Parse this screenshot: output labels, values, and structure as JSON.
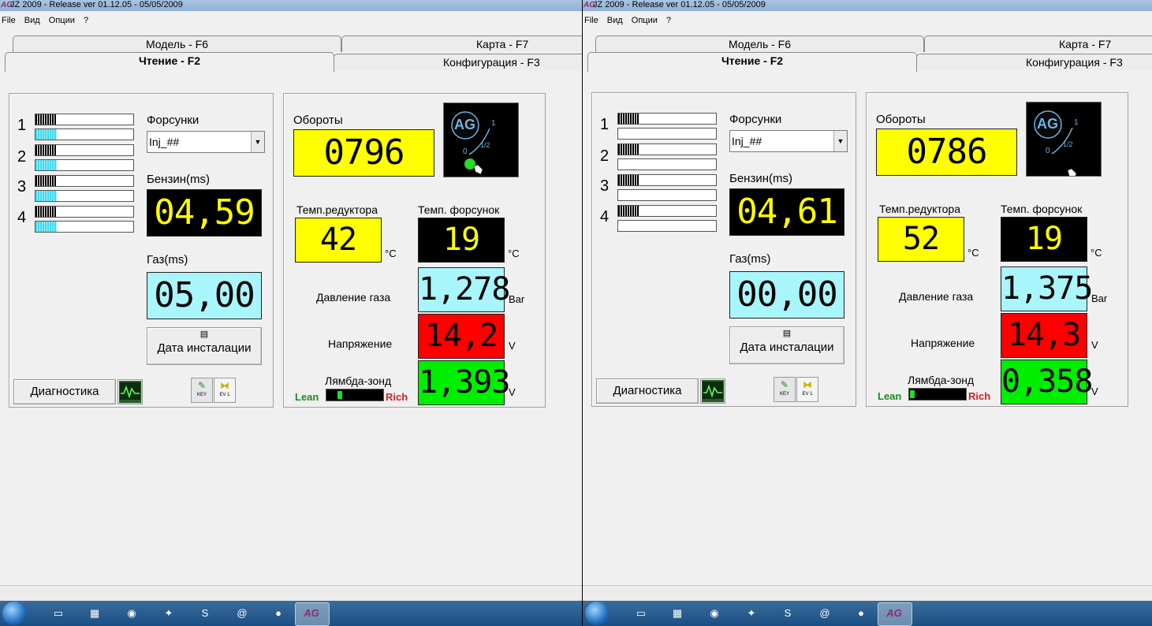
{
  "panes": [
    {
      "title": "JZ 2009  - Release  ver 01.12.05 - 05/05/2009",
      "menu": [
        "File",
        "Вид",
        "Опции",
        "?"
      ],
      "tabs": {
        "model": "Модель - F6",
        "map": "Карта - F7",
        "read": "Чтение - F2",
        "config": "Конфигурация - F3"
      },
      "injectors": {
        "numbers": [
          "1",
          "2",
          "3",
          "4"
        ],
        "petrol_fill": [
          0.22,
          0.22,
          0.22,
          0.22
        ],
        "gas_fill": [
          0.22,
          0.22,
          0.22,
          0.22
        ]
      },
      "injectors_label": "Форсунки",
      "injector_select": "Inj_##",
      "petrol_label": "Бензин(ms)",
      "petrol_value": "04,59",
      "gas_label": "Газ(ms)",
      "gas_value": "05,00",
      "install_date_button": "Дата инсталации",
      "diagnostics_button": "Диагностика",
      "rpm_label": "Обороты",
      "rpm_value": "0796",
      "ag_logo": "AG",
      "ag_scale": {
        "one": "1",
        "half": "1/2",
        "zero": "0"
      },
      "reducer_temp_label": "Темп.редуктора",
      "reducer_temp_value": "42",
      "injector_temp_label": "Темп. форсунок",
      "injector_temp_value": "19",
      "celsius": "°C",
      "gas_pressure_label": "Давление газа",
      "gas_pressure_value": "1,278",
      "pressure_unit": "Bar",
      "voltage_label": "Напряжение",
      "voltage_value": "14,2",
      "volt_unit": "V",
      "lambda_label": "Лямбда-зонд",
      "lambda_value": "1,393",
      "lean": "Lean",
      "rich": "Rich",
      "key_label": "KEY",
      "ev_label": "EV 1"
    },
    {
      "title": "JZ 2009  - Release  ver 01.12.05 - 05/05/2009",
      "menu": [
        "File",
        "Вид",
        "Опции",
        "?"
      ],
      "tabs": {
        "model": "Модель - F6",
        "map": "Карта - F7",
        "read": "Чтение - F2",
        "config": "Конфигурация - F3"
      },
      "injectors": {
        "numbers": [
          "1",
          "2",
          "3",
          "4"
        ],
        "petrol_fill": [
          0.22,
          0.22,
          0.22,
          0.22
        ],
        "gas_fill": [
          0,
          0,
          0,
          0
        ]
      },
      "injectors_label": "Форсунки",
      "injector_select": "Inj_##",
      "petrol_label": "Бензин(ms)",
      "petrol_value": "04,61",
      "gas_label": "Газ(ms)",
      "gas_value": "00,00",
      "install_date_button": "Дата инсталации",
      "diagnostics_button": "Диагностика",
      "rpm_label": "Обороты",
      "rpm_value": "0786",
      "ag_logo": "AG",
      "ag_scale": {
        "one": "1",
        "half": "1/2",
        "zero": "0"
      },
      "reducer_temp_label": "Темп.редуктора",
      "reducer_temp_value": "52",
      "injector_temp_label": "Темп. форсунок",
      "injector_temp_value": "19",
      "celsius": "°C",
      "gas_pressure_label": "Давление газа",
      "gas_pressure_value": "1,375",
      "pressure_unit": "Bar",
      "voltage_label": "Напряжение",
      "voltage_value": "14,3",
      "volt_unit": "V",
      "lambda_label": "Лямбда-зонд",
      "lambda_value": "0,358",
      "lean": "Lean",
      "rich": "Rich",
      "key_label": "KEY",
      "ev_label": "EV 1"
    }
  ],
  "colors": {
    "yellow": "#ffff00",
    "cyan": "#a8f6fc",
    "red": "#ff0000",
    "green": "#00ee00",
    "black": "#000000",
    "lcd_yellow_text": "#ffff00"
  },
  "taskbar_icons": [
    "start-orb-icon",
    "folder-icon",
    "calculator-icon",
    "driver-icon",
    "game-icon",
    "skype-icon",
    "at-icon",
    "chrome-icon",
    "ag-app-icon"
  ]
}
